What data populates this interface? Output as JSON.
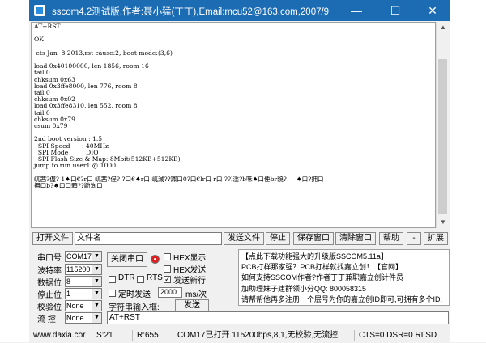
{
  "window": {
    "title": "sscom4.2测试版,作者:聂小猛(丁丁),Email:mcu52@163.com,2007/9",
    "min": "—",
    "max": "☐",
    "close": "✕"
  },
  "terminal_lines": [
    "AT+RST",
    "",
    "OK",
    "",
    " ets Jan  8 2013,rst cause:2, boot mode:(3,6)",
    "",
    "load 0x40100000, len 1856, room 16",
    "tail 0",
    "chksum 0x63",
    "load 0x3ffe8000, len 776, room 8",
    "tail 0",
    "chksum 0x02",
    "load 0x3ffe8310, len 552, room 8",
    "tail 0",
    "chksum 0x79",
    "csum 0x79",
    "",
    "2nd boot version : 1.5",
    "  SPI Speed      : 40MHz",
    "  SPI Mode       : DIO",
    "  SPI Flash Size & Map: 8Mbit(512KB+512KB)",
    "jump to run user1 @ 1000",
    "",
    "屼茜?偓? 1♠口€?r口 屼茜?侱? ?口€♠r口 屼滅??鼏口0?口€lr口 r口 ??l滥?b咊♠口倕br貌?     ♠口?拥口",
    "拥口b?♠口口顆??鼢洵口"
  ],
  "toolbar": {
    "open_file": "打开文件",
    "file_name": "文件名",
    "send_file": "发送文件",
    "stop": "停止",
    "save_window": "保存窗口",
    "clear_window": "清除窗口",
    "help": "帮助",
    "dash": "-",
    "expand": "扩展"
  },
  "serial": {
    "port_label": "串口号",
    "port_value": "COM17",
    "close_port": "关闭串口",
    "baud_label": "波特率",
    "baud_value": "115200",
    "databits_label": "数据位",
    "databits_value": "8",
    "stopbits_label": "停止位",
    "stopbits_value": "1",
    "parity_label": "校验位",
    "parity_value": "None",
    "flow_label": "流 控",
    "flow_value": "None"
  },
  "options": {
    "hex_display": "HEX显示",
    "hex_send": "HEX发送",
    "send_newline": "发送新行",
    "dtr": "DTR",
    "rts": "RTS",
    "timed_send": "定时发送",
    "interval_value": "2000",
    "interval_unit": "ms/次",
    "input_label": "字符串输入框:",
    "send_button": "发送",
    "input_value": "AT+RST"
  },
  "info_lines": [
    "【点此下载功能强大的升级版SSCOM5.11a】",
    "PCB打样那家强？PCB打样就找嘉立创！【官网】",
    "如何支持SSCOM作者?作者丁丁兼职嘉立创计件员",
    "加助理妹子建群领小分QQ: 800058315",
    "请帮帮他再多注册一个层号为你的嘉立创ID即可,可拥有多个ID."
  ],
  "status": {
    "site": "www.daxia.cor",
    "sent": "S:21",
    "received": "R:655",
    "port_state": "COM17已打开  115200bps,8,1,无校验,无流控",
    "lines": "CTS=0 DSR=0 RLSD"
  }
}
